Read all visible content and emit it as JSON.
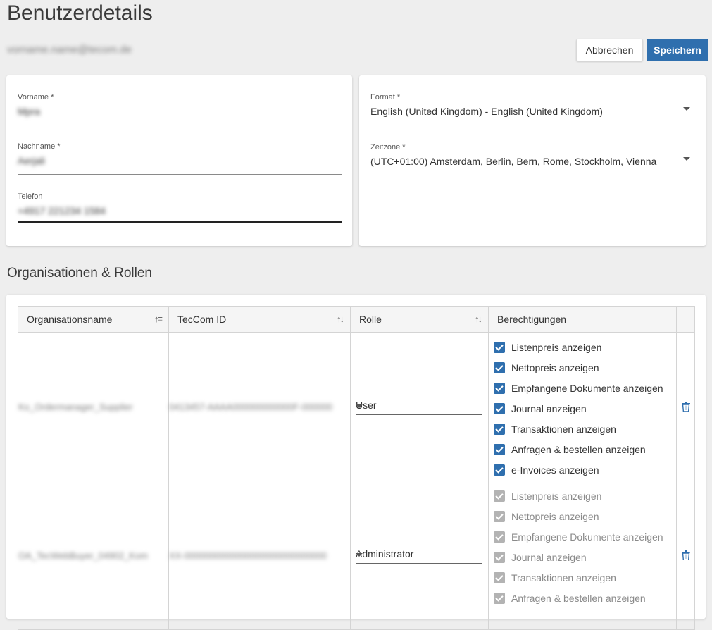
{
  "header": {
    "title": "Benutzerdetails",
    "user_email": "vorname.name@tecom.de",
    "cancel_label": "Abbrechen",
    "save_label": "Speichern"
  },
  "personal": {
    "first_name": {
      "label": "Vorname *",
      "value": "Mpra"
    },
    "last_name": {
      "label": "Nachname *",
      "value": "Aerjali"
    },
    "phone": {
      "label": "Telefon",
      "value": "+4917 221234 1584"
    }
  },
  "settings": {
    "format": {
      "label": "Format *",
      "value": "English (United Kingdom) - English (United Kingdom)"
    },
    "timezone": {
      "label": "Zeitzone *",
      "value": "(UTC+01:00) Amsterdam, Berlin, Bern, Rome, Stockholm, Vienna"
    }
  },
  "organisations": {
    "section_title": "Organisationen & Rollen",
    "columns": [
      "Organisationsname",
      "TecCom ID",
      "Rolle",
      "Berechtigungen"
    ],
    "rows": [
      {
        "org_name": "Ko_Ordermanager_Supplier",
        "teccom_id": "0413457-AAAA000000000000F-000000",
        "role": "User",
        "permissions": [
          "Listenpreis anzeigen",
          "Nettopreis anzeigen",
          "Empfangene Dokumente anzeigen",
          "Journal anzeigen",
          "Transaktionen anzeigen",
          "Anfragen & bestellen anzeigen",
          "e-Invoices anzeigen"
        ],
        "enabled": true
      },
      {
        "org_name": "OA_TecWebBuyer_04902_Kom",
        "teccom_id": "XX-0000000000000000000000000000",
        "role": "Administrator",
        "permissions": [
          "Listenpreis anzeigen",
          "Nettopreis anzeigen",
          "Empfangene Dokumente anzeigen",
          "Journal anzeigen",
          "Transaktionen anzeigen",
          "Anfragen & bestellen anzeigen"
        ],
        "enabled": false
      }
    ]
  },
  "icons": {
    "sort_asc": "sort-ascending-icon",
    "sort": "sort-icon",
    "delete": "trash-icon",
    "dropdown": "chevron-down-icon"
  },
  "colors": {
    "primary": "#2f6fae",
    "checkbox_disabled": "#b3b3b3",
    "trash": "#2f6fae"
  }
}
